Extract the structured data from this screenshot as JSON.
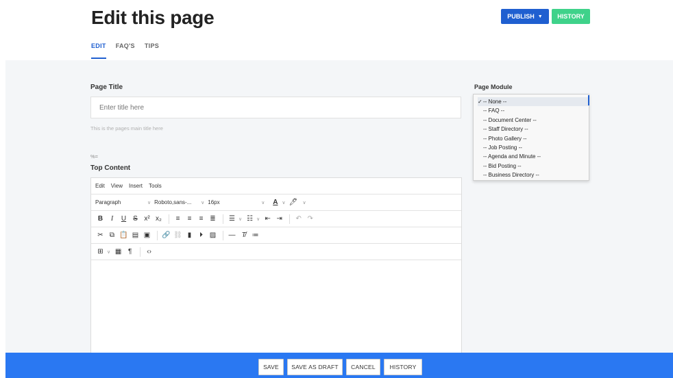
{
  "header": {
    "title": "Edit this page",
    "publish_label": "PUBLISH",
    "history_label": "HISTORY",
    "colors": {
      "publish": "#1f5fd0",
      "history": "#3fd28a"
    }
  },
  "tabs": [
    {
      "label": "EDIT",
      "active": true
    },
    {
      "label": "FAQ'S",
      "active": false
    },
    {
      "label": "TIPS",
      "active": false
    }
  ],
  "form": {
    "page_title_label": "Page Title",
    "page_title_placeholder": "Enter title here",
    "page_title_value": "",
    "page_title_help": "This is the pages main title here",
    "small_tag": "%=",
    "top_content_label": "Top Content"
  },
  "editor": {
    "menu": [
      "Edit",
      "View",
      "Insert",
      "Tools"
    ],
    "block_format": "Paragraph",
    "font_family": "Roboto,sans-...",
    "font_size": "16px",
    "toolbar_row2": [
      "B",
      "I",
      "U",
      "S",
      "x²",
      "x₂"
    ],
    "content": ""
  },
  "module": {
    "label": "Page Module",
    "options": [
      {
        "label": "-- None --",
        "selected": true
      },
      {
        "label": "-- FAQ --",
        "selected": false
      },
      {
        "label": "-- Document Center --",
        "selected": false
      },
      {
        "label": "-- Staff Directory --",
        "selected": false
      },
      {
        "label": "-- Photo Gallery --",
        "selected": false
      },
      {
        "label": "-- Job Posting --",
        "selected": false
      },
      {
        "label": "-- Agenda and Minute --",
        "selected": false
      },
      {
        "label": "-- Bid Posting --",
        "selected": false
      },
      {
        "label": "-- Business Directory --",
        "selected": false
      }
    ],
    "checkmark": "✓"
  },
  "footer": {
    "save_label": "SAVE",
    "save_draft_label": "SAVE AS DRAFT",
    "cancel_label": "CANCEL",
    "history_label": "HISTORY",
    "color": "#2a78f2"
  }
}
